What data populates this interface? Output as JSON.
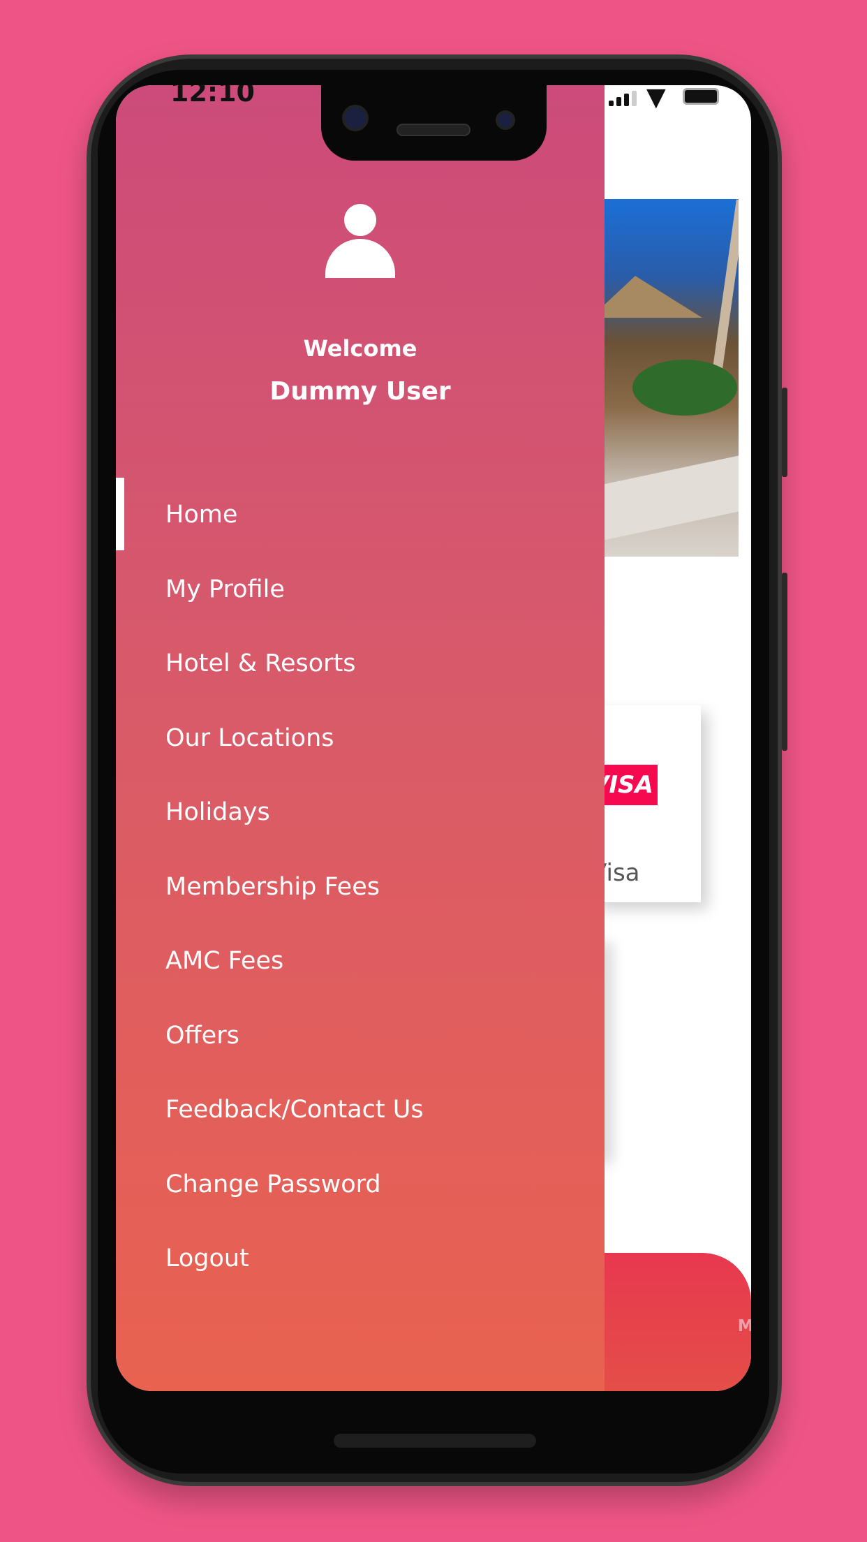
{
  "status_bar": {
    "time": "12:10",
    "signal_icon": "signal-icon",
    "wifi_icon": "wifi-icon",
    "battery_icon": "battery-icon"
  },
  "drawer": {
    "avatar_icon": "user-icon",
    "welcome": "Welcome",
    "user_name": "Dummy User",
    "active_item": "Home",
    "items": [
      {
        "label": "Home"
      },
      {
        "label": "My Profile"
      },
      {
        "label": "Hotel & Resorts"
      },
      {
        "label": "Our Locations"
      },
      {
        "label": "Holidays"
      },
      {
        "label": "Membership Fees"
      },
      {
        "label": "AMC Fees"
      },
      {
        "label": "Offers"
      },
      {
        "label": "Feedback/Contact Us"
      },
      {
        "label": "Change Password"
      },
      {
        "label": "Logout"
      }
    ]
  },
  "background_content": {
    "card": {
      "badge": "VISA",
      "label": "Visa"
    },
    "bottom_nav": {
      "member_label": "MEMBER",
      "member_icon": "user-circle-icon"
    }
  },
  "colors": {
    "page_bg": "#ee5586",
    "drawer_top": "#cc4b7a",
    "drawer_bottom": "#e96250",
    "visa_badge": "#f6094f",
    "bottom_nav": "#e8384f"
  }
}
